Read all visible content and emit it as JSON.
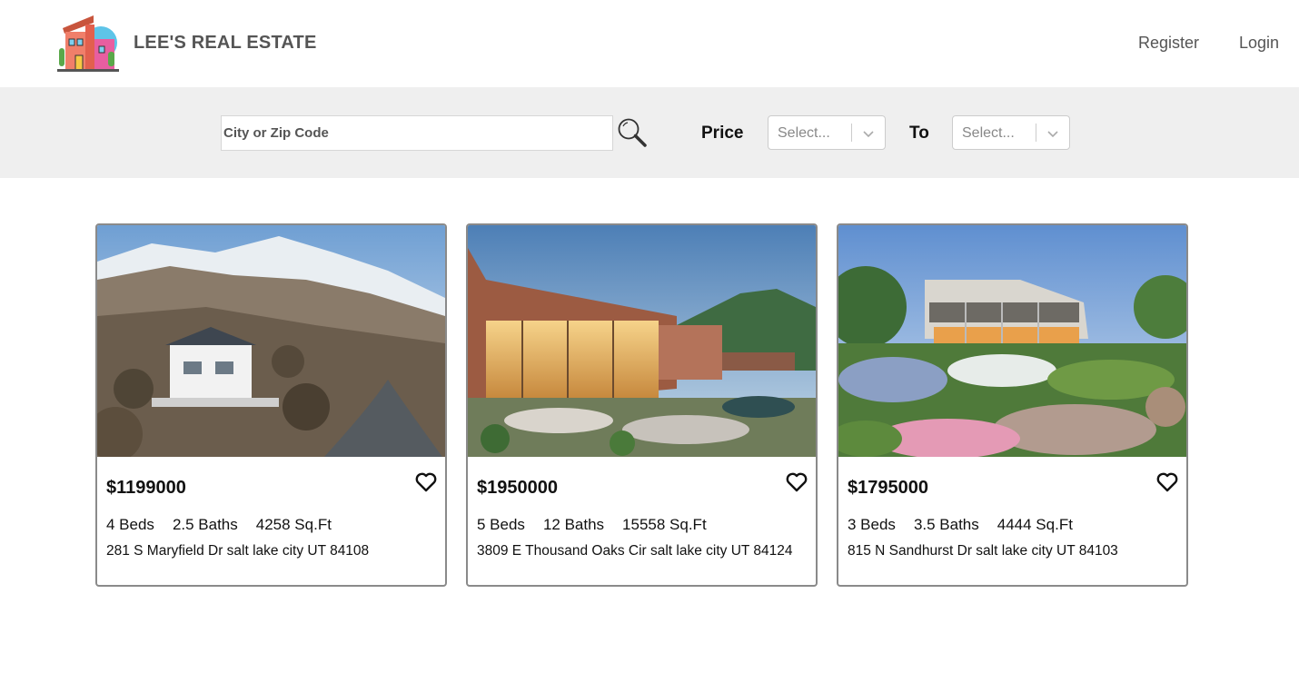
{
  "header": {
    "brand": "LEE'S REAL ESTATE",
    "register_label": "Register",
    "login_label": "Login"
  },
  "search": {
    "placeholder": "City or Zip Code",
    "price_label": "Price",
    "to_label": "To",
    "min_placeholder": "Select...",
    "max_placeholder": "Select..."
  },
  "listings": [
    {
      "price": "$1199000",
      "beds": "4 Beds",
      "baths": "2.5 Baths",
      "sqft": "4258 Sq.Ft",
      "address": "281 S Maryfield Dr salt lake city UT 84108"
    },
    {
      "price": "$1950000",
      "beds": "5 Beds",
      "baths": "12 Baths",
      "sqft": "15558 Sq.Ft",
      "address": "3809 E Thousand Oaks Cir salt lake city UT 84124"
    },
    {
      "price": "$1795000",
      "beds": "3 Beds",
      "baths": "3.5 Baths",
      "sqft": "4444 Sq.Ft",
      "address": "815 N Sandhurst Dr salt lake city UT 84103"
    }
  ],
  "icons": {
    "logo": "house-logo-icon",
    "search": "magnifier-icon",
    "dropdown": "chevron-down-icon",
    "favorite": "heart-outline-icon"
  }
}
